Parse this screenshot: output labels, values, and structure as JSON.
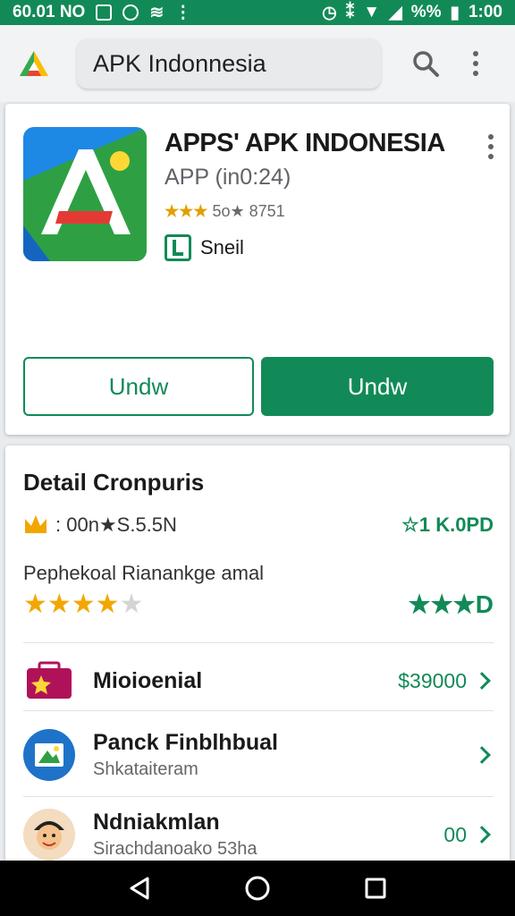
{
  "status_bar": {
    "carrier": "60.01 NO",
    "battery": "%%",
    "time": "1:00"
  },
  "search": {
    "query": "APK Indonnesia"
  },
  "app": {
    "title": "APPS' APK INDONESIA",
    "subtitle": "APP  (in0:24)",
    "rating_stars": "★★★",
    "rating_text": "5o★ 8751",
    "developer": "Sneil",
    "btn_outline_label": "Undw",
    "btn_fill_label": "Undw"
  },
  "details": {
    "title": "Detail Cronpuris",
    "row1_left": ": 00n★S.5.5N",
    "row1_right": "1 K.0PD",
    "label": "Pephekoal Rianankge amal",
    "stars_left_on": "★★★★",
    "stars_left_off": "★",
    "stars_right": "★★★D",
    "items": [
      {
        "title": "Mioioenial",
        "subtitle": "",
        "value": "$39000"
      },
      {
        "title": "Panck Finblhbual",
        "subtitle": "Shkataiteram",
        "value": ""
      },
      {
        "title": "Ndniakmlan",
        "subtitle": "Sirachdanoako 53ha",
        "value": "00"
      }
    ]
  },
  "colors": {
    "accent": "#128a57",
    "star": "#f2a600"
  }
}
